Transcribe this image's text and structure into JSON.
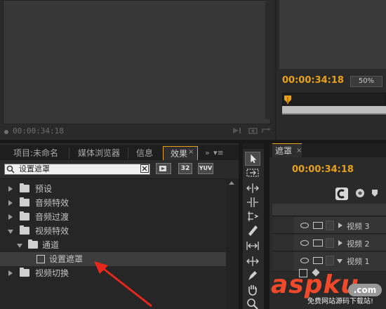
{
  "source_monitor": {
    "timecode": "00:00:34:18"
  },
  "program_monitor": {
    "timecode": "00:00:34:18",
    "zoom": "50%"
  },
  "effects_panel": {
    "tabs": [
      {
        "label": "项目:未命名"
      },
      {
        "label": "媒体浏览器"
      },
      {
        "label": "信息"
      },
      {
        "label": "效果",
        "active": true
      }
    ],
    "close_glyph": "×",
    "more_glyph": "»",
    "menu_glyph": "▾≡",
    "search": {
      "value": "设置遮罩"
    },
    "buttons": {
      "accelerated": "accelerated-effects-icon",
      "bit32": "32",
      "yuv": "YUV"
    },
    "tree": [
      {
        "label": "预设",
        "level": 0,
        "expanded": false,
        "type": "folder"
      },
      {
        "label": "音频特效",
        "level": 0,
        "expanded": false,
        "type": "folder"
      },
      {
        "label": "音频过渡",
        "level": 0,
        "expanded": false,
        "type": "folder"
      },
      {
        "label": "视频特效",
        "level": 0,
        "expanded": true,
        "type": "folder"
      },
      {
        "label": "通道",
        "level": 1,
        "expanded": true,
        "type": "folder"
      },
      {
        "label": "设置遮罩",
        "level": 2,
        "type": "effect",
        "selected": true
      },
      {
        "label": "视频切换",
        "level": 0,
        "expanded": false,
        "type": "folder"
      }
    ]
  },
  "tools": [
    "selection-tool-icon",
    "track-select-icon",
    "ripple-edit-icon",
    "rolling-edit-icon",
    "rate-stretch-icon",
    "razor-icon",
    "slip-icon",
    "slide-icon",
    "pen-icon",
    "hand-icon",
    "zoom-icon"
  ],
  "timeline": {
    "tab_label": "遮罩",
    "close_glyph": "×",
    "timecode": "00:00:34:18",
    "tracks": [
      {
        "label": "视频 3",
        "expanded": false
      },
      {
        "label": "视频 2",
        "expanded": false
      },
      {
        "label": "视频 1",
        "expanded": true
      }
    ]
  },
  "watermark": {
    "brand": "aspku",
    "suffix": ".com",
    "subtitle": "免费网站源码下载站!"
  },
  "colors": {
    "accent": "#e8a21a",
    "arrow": "#e8281c",
    "watermark": "#f04a2a"
  }
}
